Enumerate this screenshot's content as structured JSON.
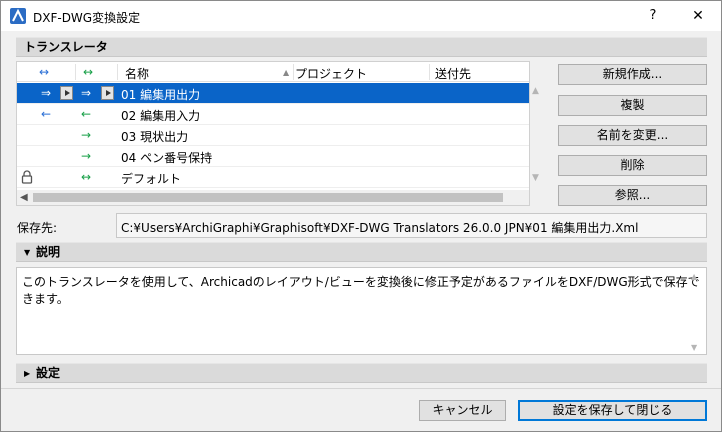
{
  "window": {
    "title": "DXF-DWG変換設定",
    "help_label": "?",
    "close_label": "✕"
  },
  "translators": {
    "section_title": "トランスレータ",
    "columns": {
      "name": "名称",
      "project": "プロジェクト",
      "send_to": "送付先"
    },
    "header_arrows": {
      "col1": "↔",
      "col2": "↔"
    },
    "rows": [
      {
        "icon": "",
        "arrow1": "⇒",
        "arrow2": "⇒",
        "name": "01 編集用出力",
        "selected": true
      },
      {
        "icon": "",
        "arrow1": "←",
        "arrow2": "←",
        "name": "02 編集用入力",
        "selected": false
      },
      {
        "icon": "",
        "arrow1": "",
        "arrow2": "→",
        "name": "03 現状出力",
        "selected": false
      },
      {
        "icon": "",
        "arrow1": "",
        "arrow2": "→",
        "name": "04 ペン番号保持",
        "selected": false
      },
      {
        "icon": "lock-icon",
        "arrow1": "",
        "arrow2": "↔",
        "name": "デフォルト",
        "selected": false
      }
    ]
  },
  "buttons": {
    "new": "新規作成...",
    "duplicate": "複製",
    "rename": "名前を変更...",
    "delete": "削除",
    "browse": "参照..."
  },
  "save": {
    "label": "保存先:",
    "path": "C:¥Users¥ArchiGraphi¥Graphisoft¥DXF-DWG Translators 26.0.0 JPN¥01 編集用出力.Xml"
  },
  "description": {
    "section_title": "説明",
    "text": "このトランスレータを使用して、Archicadのレイアウト/ビューを変換後に修正予定があるファイルをDXF/DWG形式で保存できます。"
  },
  "settings": {
    "section_title": "設定"
  },
  "footer": {
    "cancel": "キャンセル",
    "save_close": "設定を保存して閉じる"
  },
  "colors": {
    "selection": "#0a64c8",
    "arrow_blue": "#2a6fd6",
    "arrow_green": "#18a048"
  }
}
